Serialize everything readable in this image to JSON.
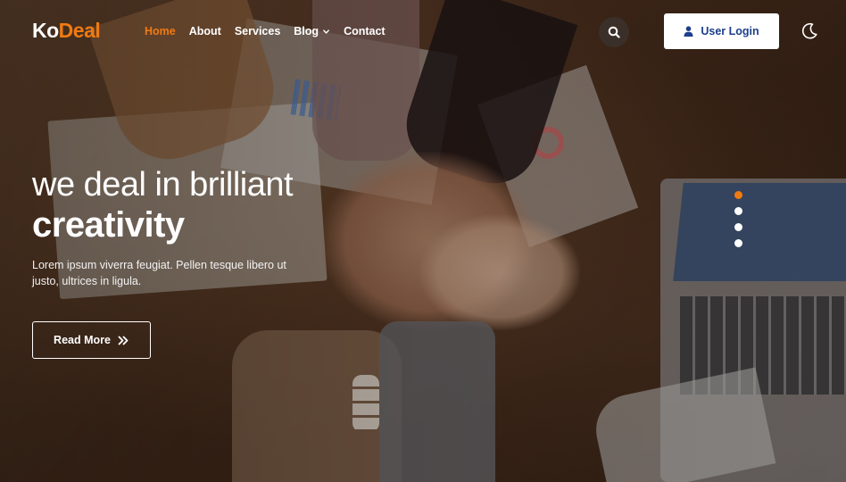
{
  "brand": {
    "logo_part1": "Ko",
    "logo_part2": "Deal",
    "accent_color": "#f07a12"
  },
  "nav": {
    "items": [
      {
        "label": "Home",
        "active": true
      },
      {
        "label": "About"
      },
      {
        "label": "Services"
      },
      {
        "label": "Blog",
        "has_dropdown": true
      },
      {
        "label": "Contact"
      }
    ],
    "search_icon": "search-icon",
    "login_label": "User Login",
    "login_icon": "user-icon",
    "theme_icon": "moon-icon"
  },
  "hero": {
    "title_line1": "we deal in brilliant",
    "title_line2": "creativity",
    "description": "Lorem ipsum viverra feugiat. Pellen tesque libero ut justo, ultrices in ligula.",
    "cta_label": "Read More",
    "cta_icon": "double-chevron-right-icon"
  },
  "slider": {
    "count": 4,
    "active_index": 0
  }
}
